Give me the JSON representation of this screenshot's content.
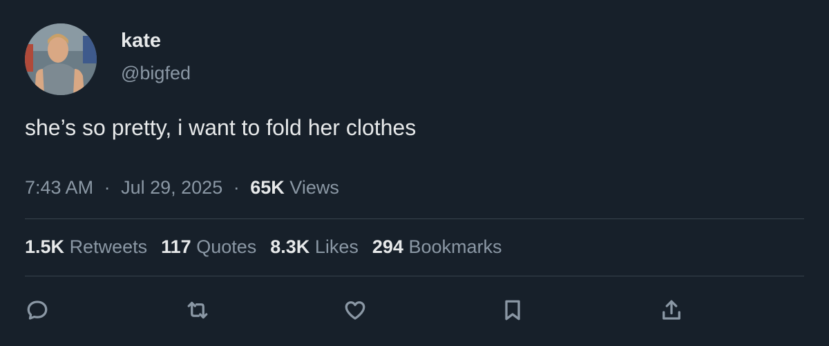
{
  "author": {
    "display_name": "kate",
    "handle": "@bigfed",
    "avatar_icon": "profile-photo"
  },
  "tweet": {
    "text": "she’s so pretty, i want to fold her clothes"
  },
  "meta": {
    "time": "7:43 AM",
    "separator": "·",
    "date": "Jul 29, 2025",
    "views_count": "65K",
    "views_label": "Views"
  },
  "stats": [
    {
      "count": "1.5K",
      "label": "Retweets"
    },
    {
      "count": "117",
      "label": "Quotes"
    },
    {
      "count": "8.3K",
      "label": "Likes"
    },
    {
      "count": "294",
      "label": "Bookmarks"
    }
  ],
  "actions": [
    {
      "icon": "reply-icon"
    },
    {
      "icon": "retweet-icon"
    },
    {
      "icon": "like-icon"
    },
    {
      "icon": "bookmark-icon"
    },
    {
      "icon": "share-icon"
    }
  ],
  "colors": {
    "background": "#17202a",
    "primary_text": "#e7e9ea",
    "secondary_text": "#8b98a5",
    "divider": "#38444d"
  }
}
